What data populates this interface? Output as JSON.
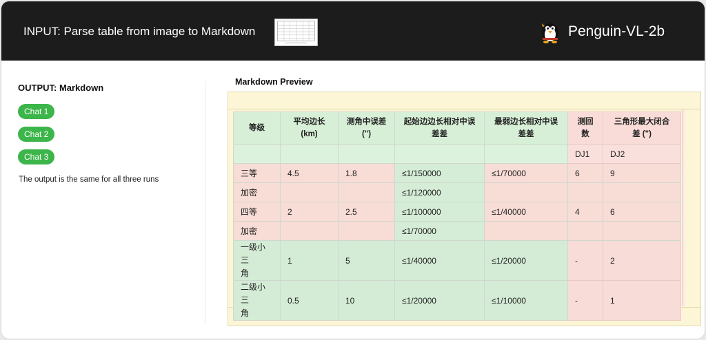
{
  "header": {
    "title": "INPUT: Parse table from image to Markdown",
    "brand_name": "Penguin-VL-2b"
  },
  "left": {
    "output_label": "OUTPUT: Markdown",
    "chats": [
      "Chat 1",
      "Chat 2",
      "Chat 3"
    ],
    "note": "The output is the same for all three runs"
  },
  "preview": {
    "label": "Markdown Preview",
    "table": {
      "headers": [
        "等级",
        "平均边长 (km)",
        "测角中误差 (\")",
        "起始边边长相对中误差差",
        "最弱边长相对中误差差",
        "测回数",
        "三角形最大闭合差 (\")"
      ],
      "header_lines": [
        [
          "等级"
        ],
        [
          "平均边长",
          "(km)"
        ],
        [
          "测角中误差",
          "(\")"
        ],
        [
          "起始边边长相对中误",
          "差差"
        ],
        [
          "最弱边长相对中误",
          "差差"
        ],
        [
          "测回",
          "数"
        ],
        [
          "三角形最大闭合",
          "差 (\")"
        ]
      ],
      "rows": [
        [
          "",
          "",
          "",
          "",
          "",
          "DJ1",
          "DJ2"
        ],
        [
          "三等",
          "4.5",
          "1.8",
          "≤1/150000",
          "≤1/70000",
          "6",
          "9"
        ],
        [
          "加密",
          "",
          "",
          "≤1/120000",
          "",
          "",
          ""
        ],
        [
          "四等",
          "2",
          "2.5",
          "≤1/100000",
          "≤1/40000",
          "4",
          "6"
        ],
        [
          "加密",
          "",
          "",
          "≤1/70000",
          "",
          "",
          ""
        ],
        [
          "一级小三角",
          "1",
          "5",
          "≤1/40000",
          "≤1/20000",
          "-",
          "2"
        ],
        [
          "二级小三角",
          "0.5",
          "10",
          "≤1/20000",
          "≤1/10000",
          "-",
          "1"
        ]
      ]
    }
  },
  "colors": {
    "header_bg": "#1c1c1c",
    "chip_green": "#3cb54a",
    "preview_yellow": "#fdf6d6",
    "cell_green": "#d9f0da",
    "cell_pink": "#f8dcd6"
  },
  "icons": {
    "brand": "penguin-icon",
    "thumbnail": "table-image-thumbnail"
  }
}
